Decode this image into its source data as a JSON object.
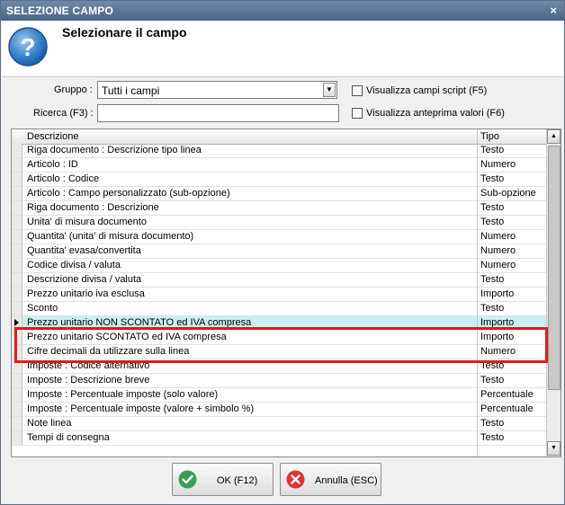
{
  "window": {
    "title": "SELEZIONE CAMPO",
    "close_glyph": "×"
  },
  "header": {
    "title": "Selezionare il campo",
    "icon": "question-icon"
  },
  "form": {
    "group_label": "Gruppo :",
    "group_value": "Tutti i campi",
    "search_label": "Ricerca (F3) :",
    "search_value": "",
    "script_fields_label": "Visualizza campi script (F5)",
    "preview_values_label": "Visualizza anteprima valori (F6)"
  },
  "grid": {
    "columns": [
      "Descrizione",
      "Tipo"
    ],
    "selected_row_index": 12,
    "rows": [
      [
        "Riga documento : Descrizione tipo linea",
        "Testo"
      ],
      [
        "Articolo : ID",
        "Numero"
      ],
      [
        "Articolo : Codice",
        "Testo"
      ],
      [
        "Articolo : Campo personalizzato (sub-opzione)",
        "Sub-opzione"
      ],
      [
        "Riga documento : Descrizione",
        "Testo"
      ],
      [
        "Unita' di misura documento",
        "Testo"
      ],
      [
        "Quantita' (unita' di misura documento)",
        "Numero"
      ],
      [
        "Quantita' evasa/convertita",
        "Numero"
      ],
      [
        "Codice divisa / valuta",
        "Numero"
      ],
      [
        "Descrizione divisa / valuta",
        "Testo"
      ],
      [
        "Prezzo unitario iva esclusa",
        "Importo"
      ],
      [
        "Sconto",
        "Testo"
      ],
      [
        "Prezzo unitario NON SCONTATO ed IVA compresa",
        "Importo"
      ],
      [
        "Prezzo unitario SCONTATO ed IVA compresa",
        "Importo"
      ],
      [
        "Cifre decimali da utilizzare sulla linea",
        "Numero"
      ],
      [
        "Imposte : Codice alternativo",
        "Testo"
      ],
      [
        "Imposte : Descrizione breve",
        "Testo"
      ],
      [
        "Imposte : Percentuale imposte (solo valore)",
        "Percentuale"
      ],
      [
        "Imposte : Percentuale imposte (valore + simbolo %)",
        "Percentuale"
      ],
      [
        "Note linea",
        "Testo"
      ],
      [
        "Tempi di consegna",
        "Testo"
      ]
    ]
  },
  "buttons": {
    "ok_label": "OK (F12)",
    "cancel_label": "Annulla (ESC)"
  },
  "colors": {
    "highlight": "#e01a1a",
    "selected_row": "#c8f1f1",
    "titlebar": "#5b7696"
  }
}
